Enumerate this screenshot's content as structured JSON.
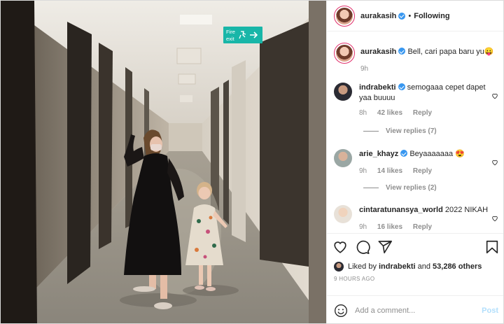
{
  "photo": {
    "exit_sign_line1": "Fire",
    "exit_sign_line2": "exit"
  },
  "header": {
    "username": "aurakasih",
    "separator": "•",
    "follow_label": "Following"
  },
  "comments": [
    {
      "username": "aurakasih",
      "text": "Bell, cari papa baru yu😛",
      "time": "9h",
      "likes": "",
      "reply": "",
      "view_replies": ""
    },
    {
      "username": "indrabekti",
      "text": "semogaaa cepet dapet yaa buuuu",
      "time": "8h",
      "likes": "42 likes",
      "reply": "Reply",
      "view_replies": "View replies (7)"
    },
    {
      "username": "arie_khayz",
      "text": "Beyaaaaaaa 😍",
      "time": "9h",
      "likes": "14 likes",
      "reply": "Reply",
      "view_replies": "View replies (2)"
    },
    {
      "username": "cintaratunansya_world",
      "text": "2022 NIKAH",
      "time": "9h",
      "likes": "16 likes",
      "reply": "Reply",
      "view_replies": ""
    }
  ],
  "likes": {
    "prefix": "Liked by ",
    "first_user": "indrabekti",
    "middle": " and ",
    "count": "53,286 others"
  },
  "posted_ago": "9 HOURS AGO",
  "add_comment": {
    "placeholder": "Add a comment...",
    "post_label": "Post"
  },
  "colors": {
    "verified": "#3897f0",
    "post_disabled": "#b2dffc",
    "exit_sign": "#18b6a8",
    "meta_gray": "#8e8e8e"
  },
  "icons": [
    "heart-icon",
    "comment-icon",
    "share-icon",
    "bookmark-icon",
    "emoji-icon",
    "verified-icon"
  ]
}
